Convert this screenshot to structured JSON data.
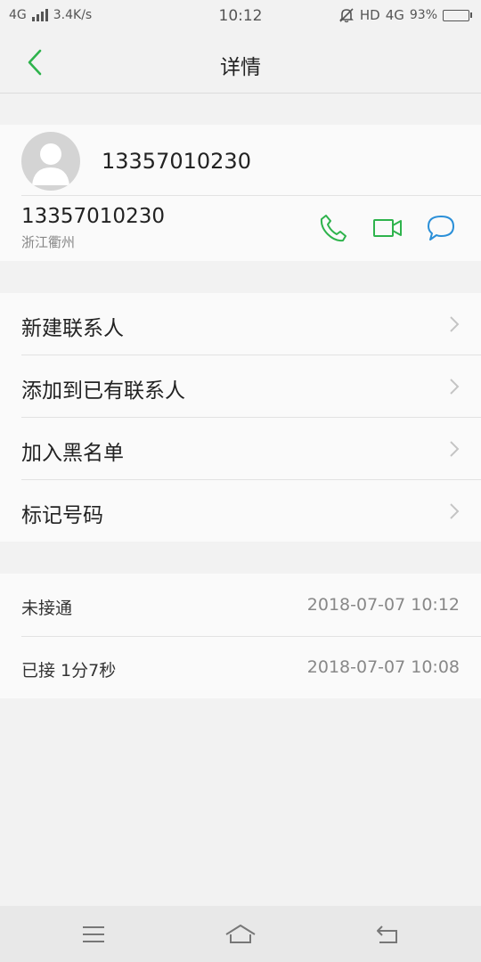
{
  "status_bar": {
    "network": "4G",
    "speed": "3.4K/s",
    "time": "10:12",
    "hd": "HD",
    "network_right": "4G",
    "battery": "93%",
    "battery_level": 0.93
  },
  "header": {
    "title": "详情",
    "back_icon": "chevron-left-icon"
  },
  "contact": {
    "name": "13357010230",
    "number": "13357010230",
    "location": "浙江衢州",
    "avatar_icon": "person-icon",
    "actions": [
      {
        "name": "call-icon",
        "color": "#2eb34c"
      },
      {
        "name": "video-call-icon",
        "color": "#2eb34c"
      },
      {
        "name": "message-icon",
        "color": "#2a8fd8"
      }
    ]
  },
  "menu": {
    "items": [
      {
        "label": "新建联系人"
      },
      {
        "label": "添加到已有联系人"
      },
      {
        "label": "加入黑名单"
      },
      {
        "label": "标记号码"
      }
    ]
  },
  "history": {
    "rows": [
      {
        "status": "未接通",
        "time": "2018-07-07 10:12"
      },
      {
        "status": "已接 1分7秒",
        "time": "2018-07-07 10:08"
      }
    ]
  },
  "colors": {
    "accent": "#2eb34c",
    "message": "#2a8fd8",
    "background": "#f2f2f2",
    "card": "#fafafa"
  }
}
